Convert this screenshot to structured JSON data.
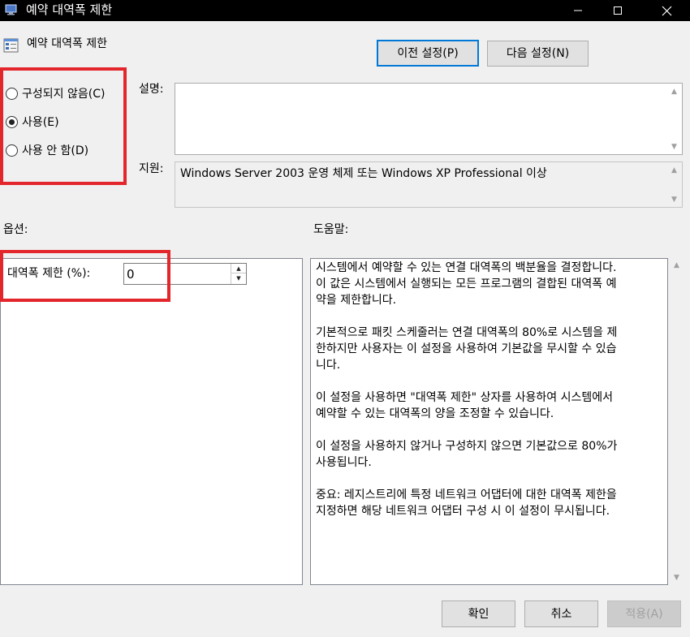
{
  "window": {
    "title": "예약 대역폭 제한",
    "icon": "policy-window-icon",
    "controls": {
      "minimize": "—",
      "maximize": "☐",
      "close": "✕"
    }
  },
  "header": {
    "title": "예약 대역폭 제한",
    "icon": "policy-setting-icon",
    "prev_button": "이전 설정(P)",
    "next_button": "다음 설정(N)"
  },
  "state": {
    "options": [
      {
        "label": "구성되지 않음(C)",
        "selected": false
      },
      {
        "label": "사용(E)",
        "selected": true
      },
      {
        "label": "사용 안 함(D)",
        "selected": false
      }
    ]
  },
  "comment": {
    "label": "설명:",
    "value": ""
  },
  "support": {
    "label": "지원:",
    "value": "Windows Server 2003 운영 체제 또는 Windows XP Professional 이상"
  },
  "options_panel": {
    "label": "옵션:",
    "field_label": "대역폭 제한 (%):",
    "field_value": "0"
  },
  "help": {
    "label": "도움말:",
    "paragraphs": [
      "시스템에서 예약할 수 있는 연결 대역폭의 백분율을 결정합니다.\n이 값은 시스템에서 실행되는 모든 프로그램의 결합된 대역폭 예\n약을 제한합니다.",
      "기본적으로 패킷 스케줄러는 연결 대역폭의 80%로 시스템을 제\n한하지만 사용자는 이 설정을 사용하여 기본값을 무시할 수 있습\n니다.",
      "이 설정을 사용하면 \"대역폭 제한\" 상자를 사용하여 시스템에서\n예약할 수 있는 대역폭의 양을 조정할 수 있습니다.",
      "이 설정을 사용하지 않거나 구성하지 않으면 기본값으로 80%가\n사용됩니다.",
      "중요: 레지스트리에 특정 네트워크 어댑터에 대한 대역폭 제한을\n지정하면 해당 네트워크 어댑터 구성 시 이 설정이 무시됩니다."
    ]
  },
  "footer": {
    "ok": "확인",
    "cancel": "취소",
    "apply": "적용(A)"
  },
  "colors": {
    "highlight_box": "#e3262b",
    "primary_button_border": "#0078d7",
    "titlebar": "#000000"
  }
}
